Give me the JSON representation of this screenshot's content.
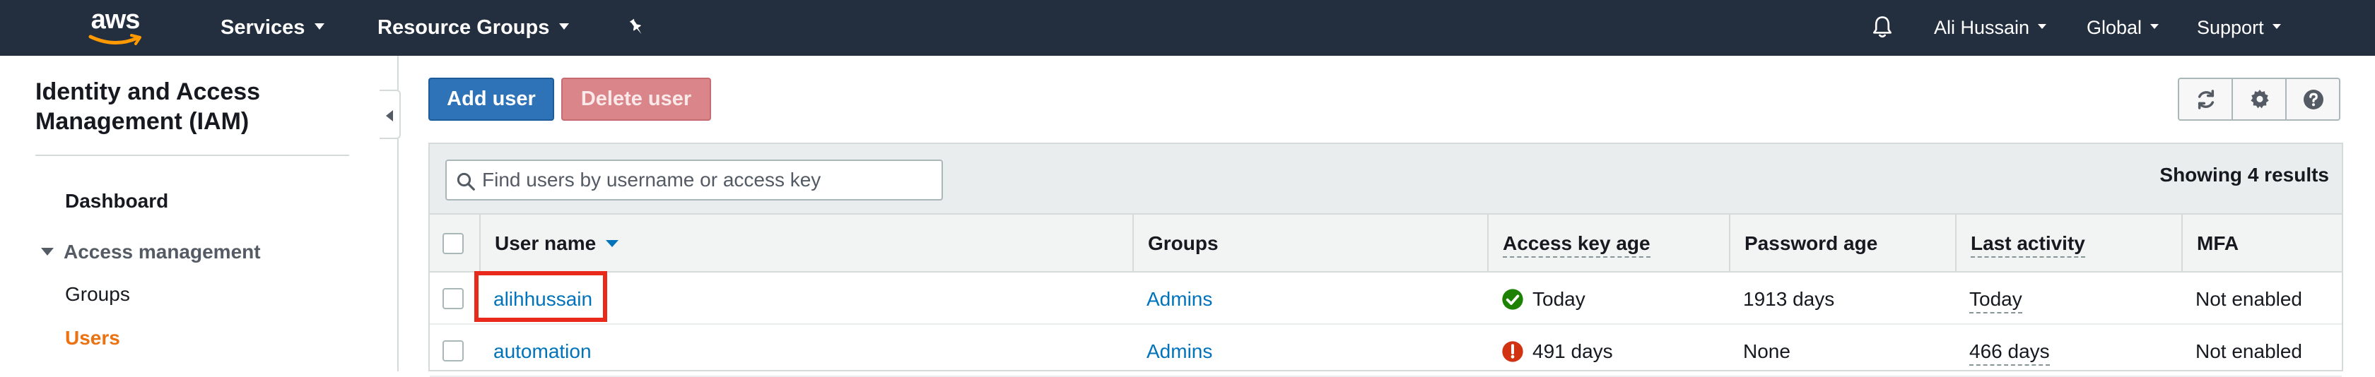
{
  "topnav": {
    "logo_text": "aws",
    "services_label": "Services",
    "resource_groups_label": "Resource Groups",
    "pin_icon": "pin-icon",
    "bell_icon": "bell-icon",
    "user_label": "Ali Hussain",
    "region_label": "Global",
    "support_label": "Support"
  },
  "sidebar": {
    "title": "Identity and Access Management (IAM)",
    "dashboard": "Dashboard",
    "section_label": "Access management",
    "items": [
      {
        "label": "Groups",
        "active": false
      },
      {
        "label": "Users",
        "active": true
      }
    ],
    "active_color": "#ec7211"
  },
  "toolbar": {
    "add_user_label": "Add user",
    "delete_user_label": "Delete user",
    "icons": [
      "refresh-icon",
      "gear-icon",
      "help-icon"
    ]
  },
  "table": {
    "search_placeholder": "Find users by username or access key",
    "showing_text": "Showing 4 results",
    "columns": [
      "User name",
      "Groups",
      "Access key age",
      "Password age",
      "Last activity",
      "MFA"
    ],
    "rows": [
      {
        "username": "alihhussain",
        "groups": "Admins",
        "access_key_status": "ok",
        "access_key_age": "Today",
        "password_age": "1913 days",
        "last_activity": "Today",
        "mfa": "Not enabled"
      },
      {
        "username": "automation",
        "groups": "Admins",
        "access_key_status": "warning",
        "access_key_age": "491 days",
        "password_age": "None",
        "last_activity": "466 days",
        "mfa": "Not enabled"
      }
    ]
  },
  "colors": {
    "nav_bg": "#232f3e",
    "primary_button": "#2e73b8",
    "danger_button": "#d9858a",
    "link": "#0073bb",
    "ok_icon": "#1d8102",
    "warning_icon": "#d13212",
    "highlight_box": "#e8291c"
  }
}
